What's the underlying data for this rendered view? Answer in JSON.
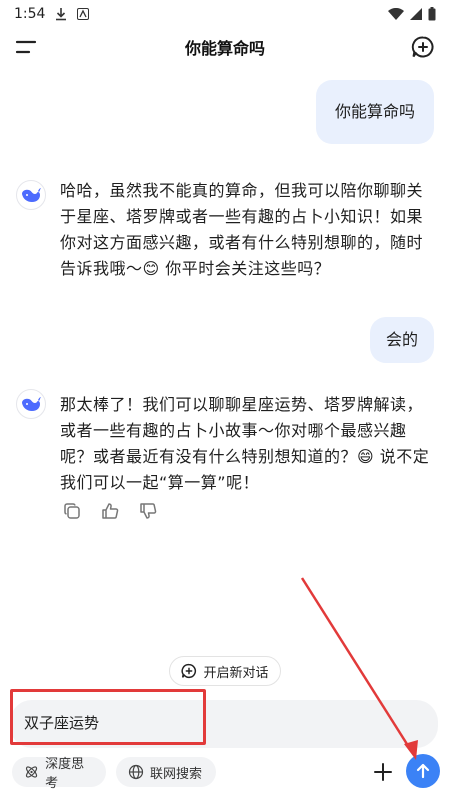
{
  "status_bar": {
    "time": "1:54"
  },
  "header": {
    "title": "你能算命吗"
  },
  "messages": [
    {
      "role": "user",
      "text": "你能算命吗"
    },
    {
      "role": "bot",
      "text": "哈哈，虽然我不能真的算命，但我可以陪你聊聊关于星座、塔罗牌或者一些有趣的占卜小知识！如果你对这方面感兴趣，或者有什么特别想聊的，随时告诉我哦～😊 你平时会关注这些吗？"
    },
    {
      "role": "user",
      "text": "会的"
    },
    {
      "role": "bot",
      "text": "那太棒了！我们可以聊聊星座运势、塔罗牌解读，或者一些有趣的占卜小故事～你对哪个最感兴趣呢？或者最近有没有什么特别想知道的？😄 说不定我们可以一起“算一算”呢！"
    }
  ],
  "new_chat": {
    "label": "开启新对话"
  },
  "input": {
    "value": "双子座运势"
  },
  "toolbar": {
    "deep_think_label": "深度思考",
    "web_search_label": "联网搜索"
  },
  "colors": {
    "accent": "#3b82f6",
    "user_bubble": "#e9f0fd",
    "annotation": "#e23a3a"
  },
  "icons": [
    "menu-icon",
    "new-chat-icon",
    "copy-icon",
    "thumbs-up-icon",
    "thumbs-down-icon",
    "atom-icon",
    "globe-icon",
    "plus-icon",
    "send-arrow-icon"
  ]
}
